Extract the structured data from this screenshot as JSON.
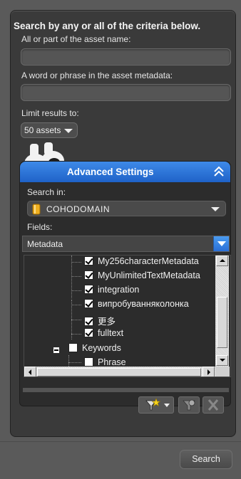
{
  "search": {
    "heading": "Search by any or all of the criteria below.",
    "name_label": "All or part of the asset name:",
    "name_value": "",
    "metadata_label": "A word or phrase in the asset metadata:",
    "metadata_value": "",
    "limit_label": "Limit results to:",
    "limit_value": "50 assets",
    "submit_label": "Search"
  },
  "advanced": {
    "title": "Advanced Settings",
    "search_in_label": "Search in:",
    "location_value": "COHODOMAIN",
    "fields_label": "Fields:",
    "fields_value": "Metadata",
    "tree_items": [
      {
        "label": "My256characterMetadata",
        "checked": true
      },
      {
        "label": "MyUnlimitedTextMetadata",
        "checked": true
      },
      {
        "label": "integration",
        "checked": true
      },
      {
        "label": "випробуванняколонка",
        "checked": true
      },
      {
        "label": "更多",
        "checked": true
      },
      {
        "label": "fulltext",
        "checked": true
      },
      {
        "label": "Keywords",
        "checked": false
      },
      {
        "label": "Phrase",
        "checked": false
      }
    ]
  },
  "icons": {
    "binoculars": "binoculars-icon",
    "collapse": "double-chevron-up-icon",
    "database": "database-icon",
    "filter_star": "filter-star-icon",
    "settings_filter": "filter-settings-icon",
    "clear": "close-icon"
  },
  "colors": {
    "accent": "#2f74dc",
    "panel": "#3a3a3a",
    "background": "#5a5a5a"
  }
}
